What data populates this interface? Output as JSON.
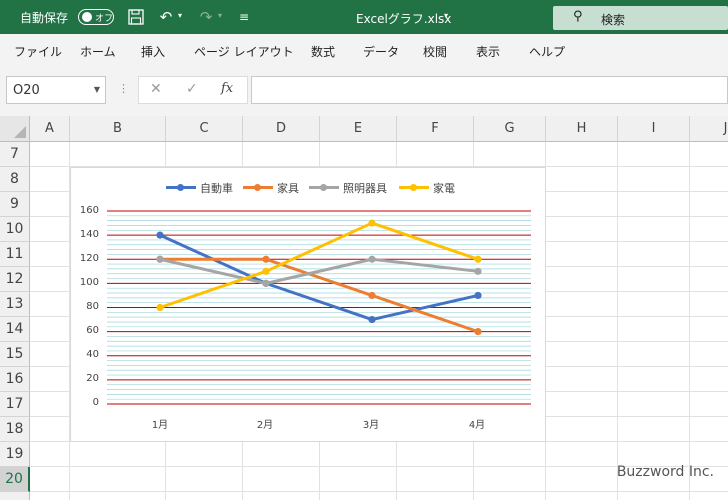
{
  "titlebar": {
    "autosave_label": "自動保存",
    "toggle_state": "オフ",
    "filename": "Excelグラフ.xlsx",
    "search_label": "検索",
    "bg_color": "#217346",
    "icons": [
      "save-icon",
      "undo-icon",
      "redo-icon",
      "customize-icon",
      "search-icon"
    ]
  },
  "menu": {
    "items": [
      "ファイル",
      "ホーム",
      "挿入",
      "ページ レイアウト",
      "数式",
      "データ",
      "校閲",
      "表示",
      "ヘルプ"
    ]
  },
  "formula_bar": {
    "name_box": "O20",
    "fx_label": "fx",
    "value": ""
  },
  "grid": {
    "columns": [
      "A",
      "B",
      "C",
      "D",
      "E",
      "F",
      "G",
      "H",
      "I",
      "J"
    ],
    "rows": [
      "7",
      "8",
      "9",
      "10",
      "11",
      "12",
      "13",
      "14",
      "15",
      "16",
      "17",
      "18",
      "19",
      "20"
    ],
    "selected_row": "20"
  },
  "chart_data": {
    "type": "line",
    "categories": [
      "1月",
      "2月",
      "3月",
      "4月"
    ],
    "series": [
      {
        "name": "自動車",
        "color": "#4472C4",
        "values": [
          140,
          100,
          70,
          90
        ]
      },
      {
        "name": "家具",
        "color": "#ED7D31",
        "values": [
          120,
          120,
          90,
          60
        ]
      },
      {
        "name": "照明器具",
        "color": "#A5A5A5",
        "values": [
          120,
          100,
          120,
          110
        ]
      },
      {
        "name": "家電",
        "color": "#FFC000",
        "values": [
          80,
          110,
          150,
          120
        ]
      }
    ],
    "y_ticks": [
      "160",
      "140",
      "120",
      "100",
      "80",
      "60",
      "40",
      "20",
      "0"
    ],
    "ylim": [
      0,
      160
    ],
    "major_gridline_color": "#C00000",
    "minor_gridline_color": "#9DD5DC",
    "legend_position": "top"
  },
  "watermark": "Buzzword Inc."
}
